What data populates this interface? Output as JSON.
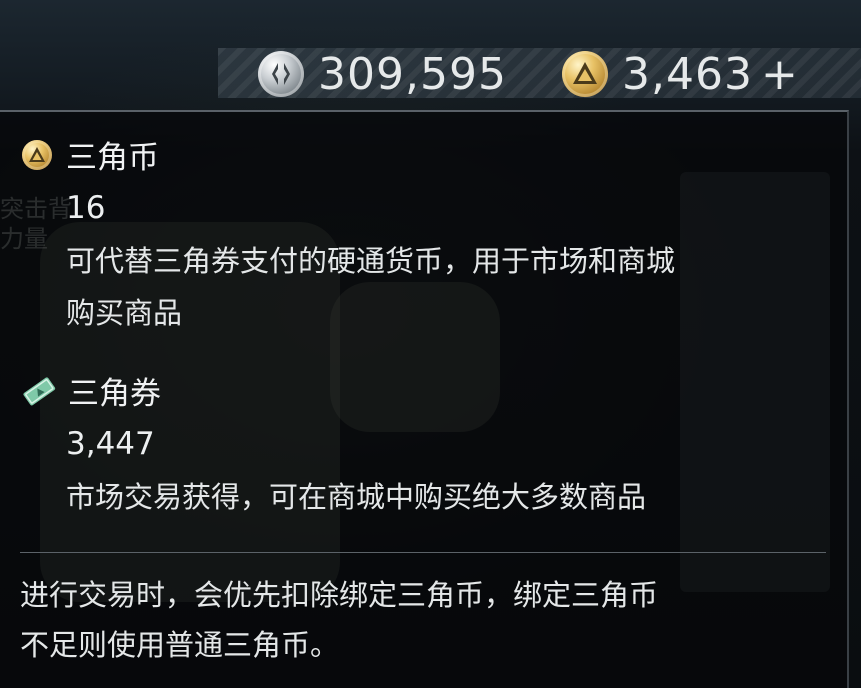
{
  "topbar": {
    "silver_icon": "silver-coin-icon",
    "silver_amount": "309,595",
    "gold_icon": "triangle-coin-icon",
    "gold_amount": "3,463",
    "add_symbol": "+"
  },
  "background_text": [
    "突击背",
    "力量"
  ],
  "tooltip": {
    "items": [
      {
        "icon": "triangle-coin-icon",
        "name": "三角币",
        "amount": "16",
        "desc_lines": [
          "可代替三角券支付的硬通货币，用于市场和商城",
          "购买商品"
        ]
      },
      {
        "icon": "triangle-voucher-icon",
        "name": "三角券",
        "amount": "3,447",
        "desc_lines": [
          "市场交易获得，可在商城中购买绝大多数商品"
        ]
      }
    ],
    "note_lines": [
      "进行交易时，会优先扣除绑定三角币，绑定三角币",
      "不足则使用普通三角币。"
    ]
  },
  "colors": {
    "text": "#e6e9ea",
    "gold": "#d9b25a",
    "silver": "#c9ced2",
    "voucher_green": "#7fc9a8",
    "panel_border": "#5a6168"
  }
}
